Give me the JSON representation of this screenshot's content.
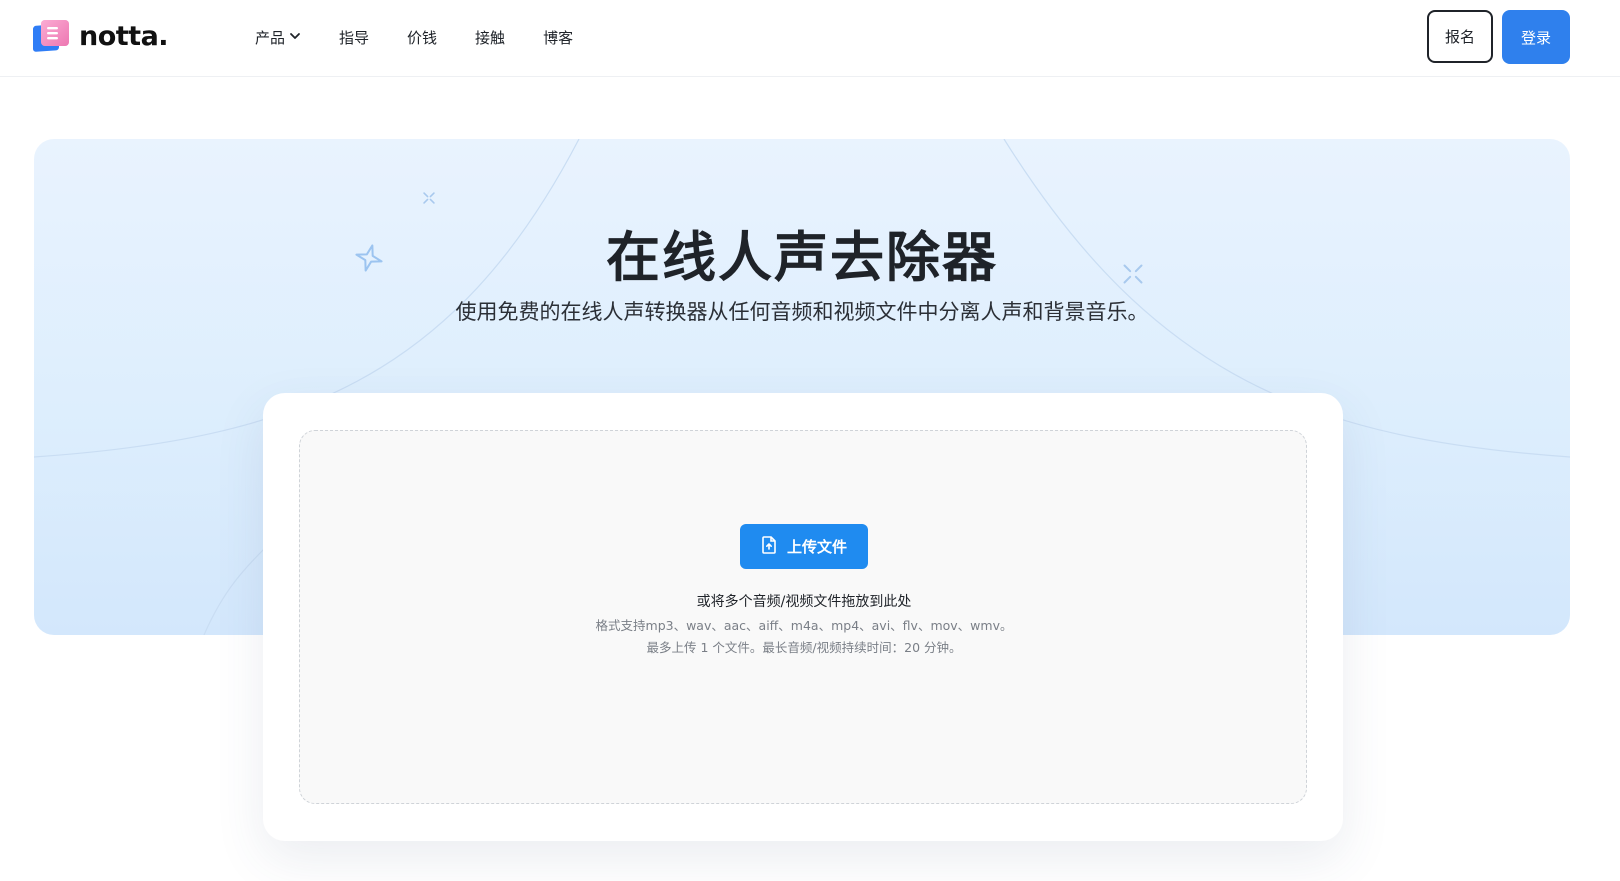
{
  "header": {
    "logo_text": "notta.",
    "nav": [
      {
        "label": "产品",
        "has_dropdown": true
      },
      {
        "label": "指导"
      },
      {
        "label": "价钱"
      },
      {
        "label": "接触"
      },
      {
        "label": "博客"
      }
    ],
    "signup_label": "报名",
    "login_label": "登录"
  },
  "hero": {
    "title": "在线人声去除器",
    "subtitle": "使用免费的在线人声转换器从任何音频和视频文件中分离人声和背景音乐。"
  },
  "upload": {
    "button_label": "上传文件",
    "drop_text": "或将多个音频/视频文件拖放到此处",
    "formats_text": "格式支持mp3、wav、aac、aiff、m4a、mp4、avi、flv、mov、wmv。",
    "limits_text": "最多上传 1 个文件。最长音频/视频持续时间：20 分钟。"
  },
  "colors": {
    "accent": "#2f80ed",
    "upload_button": "#1f8bf0",
    "hero_bg": "#e3f0fd"
  },
  "icons": {
    "logo": "notta-logo-mark",
    "dropdown": "chevron-down-icon",
    "upload": "file-upload-icon",
    "sparkles": [
      "sparkle-icon",
      "star-outline-icon"
    ]
  }
}
